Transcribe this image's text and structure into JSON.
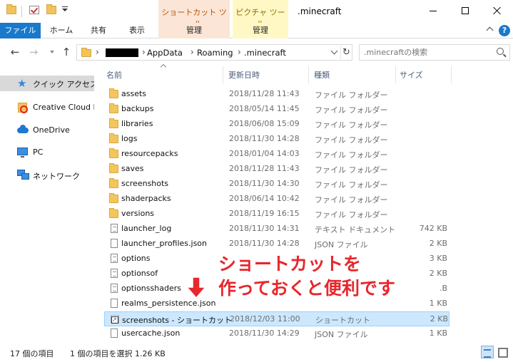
{
  "title_bar": {
    "window_title": ".minecraft",
    "context_tabs": [
      {
        "title": "ショートカット ツール",
        "tab_label": "管理"
      },
      {
        "title": "ピクチャ ツール",
        "tab_label": "管理"
      }
    ],
    "quick_access_icons": [
      "folder-icon",
      "properties-check-icon",
      "new-folder-icon",
      "customize-dropdown-icon"
    ]
  },
  "ribbon": {
    "tabs": [
      "ファイル",
      "ホーム",
      "共有",
      "表示"
    ],
    "help_glyph": "?",
    "file_tab_color": "#1979ca"
  },
  "address_bar": {
    "crumbs": [
      "AppData",
      "Roaming",
      ".minecraft"
    ],
    "search_placeholder": ".minecraftの検索"
  },
  "navigation_pane": {
    "items": [
      {
        "label": "クイック アクセス",
        "icon": "star-icon",
        "selected": true
      },
      {
        "label": "Creative Cloud Files",
        "icon": "creative-cloud-icon",
        "selected": false
      },
      {
        "label": "OneDrive",
        "icon": "onedrive-icon",
        "selected": false
      },
      {
        "label": "PC",
        "icon": "pc-icon",
        "selected": false
      },
      {
        "label": "ネットワーク",
        "icon": "network-icon",
        "selected": false
      }
    ]
  },
  "file_list": {
    "columns": [
      "名前",
      "更新日時",
      "種類",
      "サイズ"
    ],
    "rows": [
      {
        "name": "assets",
        "date": "2018/11/28 11:43",
        "type": "ファイル フォルダー",
        "size": "",
        "icon": "folder"
      },
      {
        "name": "backups",
        "date": "2018/05/14 11:45",
        "type": "ファイル フォルダー",
        "size": "",
        "icon": "folder"
      },
      {
        "name": "libraries",
        "date": "2018/06/08 15:09",
        "type": "ファイル フォルダー",
        "size": "",
        "icon": "folder"
      },
      {
        "name": "logs",
        "date": "2018/11/30 14:28",
        "type": "ファイル フォルダー",
        "size": "",
        "icon": "folder"
      },
      {
        "name": "resourcepacks",
        "date": "2018/01/04 14:03",
        "type": "ファイル フォルダー",
        "size": "",
        "icon": "folder"
      },
      {
        "name": "saves",
        "date": "2018/11/28 11:43",
        "type": "ファイル フォルダー",
        "size": "",
        "icon": "folder"
      },
      {
        "name": "screenshots",
        "date": "2018/11/30 14:30",
        "type": "ファイル フォルダー",
        "size": "",
        "icon": "folder"
      },
      {
        "name": "shaderpacks",
        "date": "2018/06/14 10:42",
        "type": "ファイル フォルダー",
        "size": "",
        "icon": "folder"
      },
      {
        "name": "versions",
        "date": "2018/11/19 16:15",
        "type": "ファイル フォルダー",
        "size": "",
        "icon": "folder"
      },
      {
        "name": "launcher_log",
        "date": "2018/11/30 14:31",
        "type": "テキスト ドキュメント",
        "size": "742 KB",
        "icon": "doc"
      },
      {
        "name": "launcher_profiles.json",
        "date": "2018/11/30 14:28",
        "type": "JSON ファイル",
        "size": "2 KB",
        "icon": "doc"
      },
      {
        "name": "options",
        "date": "",
        "type": "",
        "size": "3 KB",
        "icon": "doc"
      },
      {
        "name": "optionsof",
        "date": "",
        "type": "",
        "size": "2 KB",
        "icon": "doc"
      },
      {
        "name": "optionsshaders",
        "date": "",
        "type": "",
        "size": ".B",
        "icon": "doc"
      },
      {
        "name": "realms_persistence.json",
        "date": "",
        "type": "",
        "size": "1 KB",
        "icon": "doc"
      },
      {
        "name": "screenshots - ショートカット",
        "date": "2018/12/03 11:00",
        "type": "ショートカット",
        "size": "2 KB",
        "icon": "shortcut",
        "selected": true
      },
      {
        "name": "usercache.json",
        "date": "2018/11/30 14:29",
        "type": "JSON ファイル",
        "size": "1 KB",
        "icon": "doc"
      }
    ]
  },
  "annotation": {
    "line1": "ショートカットを",
    "line2": "作っておくと便利です",
    "color": "#e8262c"
  },
  "status_bar": {
    "item_count": "17 個の項目",
    "selection": "1 個の項目を選択  1.26 KB"
  }
}
